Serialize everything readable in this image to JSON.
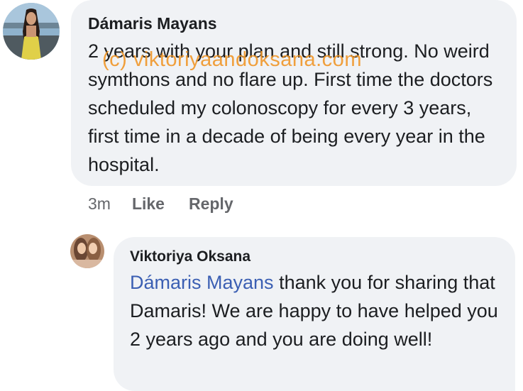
{
  "comment": {
    "author": "Dámaris Mayans",
    "text": "2 years with your plan and still strong. No weird symthons and no flare up. First time the doctors scheduled my colonoscopy for every 3 years, first time in a decade of being every year in the hospital.",
    "timestamp": "3m",
    "like_label": "Like",
    "reply_label": "Reply",
    "watermark": "(c) viktoriyaandoksana.com"
  },
  "reply": {
    "author": "Viktoriya Oksana",
    "mention": "Dámaris Mayans",
    "text": " thank you for sharing that Damaris! We are happy to have helped you 2 years ago and you are doing well!"
  },
  "colors": {
    "bubble": "#f0f2f5",
    "mention": "#3b5fb3",
    "meta": "#65676b",
    "text": "#1c1e21",
    "watermark": "#f0962a"
  },
  "icons": {
    "comment_avatar": "profile-photo",
    "reply_avatar": "profile-photo"
  }
}
